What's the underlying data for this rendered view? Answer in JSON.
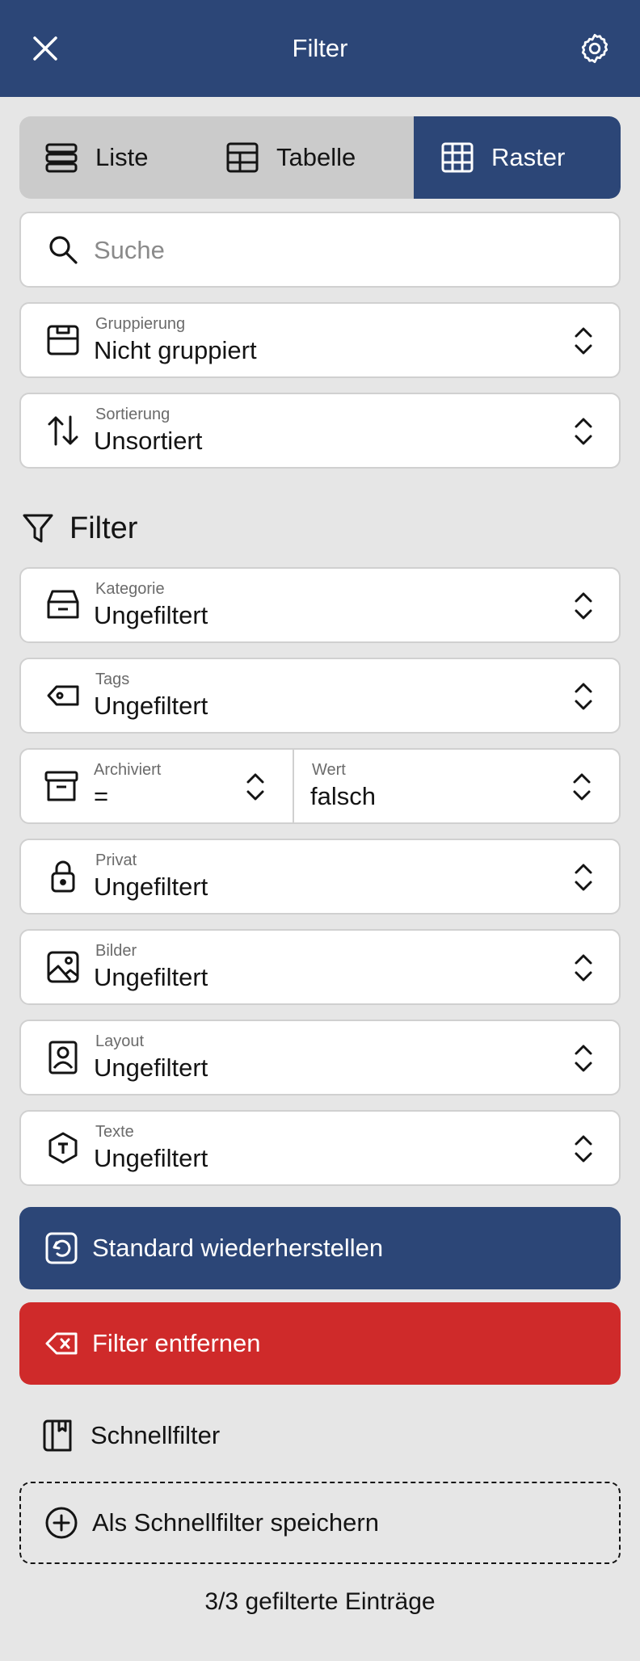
{
  "header": {
    "title": "Filter",
    "close_icon": "close-icon",
    "settings_icon": "gear-icon"
  },
  "view_modes": [
    {
      "label": "Liste",
      "icon": "list-icon",
      "active": false
    },
    {
      "label": "Tabelle",
      "icon": "table-icon",
      "active": false
    },
    {
      "label": "Raster",
      "icon": "grid-icon",
      "active": true
    }
  ],
  "search": {
    "placeholder": "Suche"
  },
  "grouping": {
    "label": "Gruppierung",
    "value": "Nicht gruppiert"
  },
  "sorting": {
    "label": "Sortierung",
    "value": "Unsortiert"
  },
  "filter_section": {
    "title": "Filter"
  },
  "filters": {
    "kategorie": {
      "label": "Kategorie",
      "value": "Ungefiltert"
    },
    "tags": {
      "label": "Tags",
      "value": "Ungefiltert"
    },
    "archiviert": {
      "label": "Archiviert",
      "operator": "=",
      "value_label": "Wert",
      "value": "falsch"
    },
    "privat": {
      "label": "Privat",
      "value": "Ungefiltert"
    },
    "bilder": {
      "label": "Bilder",
      "value": "Ungefiltert"
    },
    "layout": {
      "label": "Layout",
      "value": "Ungefiltert"
    },
    "texte": {
      "label": "Texte",
      "value": "Ungefiltert"
    }
  },
  "actions": {
    "restore_default": "Standard wiederherstellen",
    "remove_filter": "Filter entfernen"
  },
  "quick_filters": {
    "title": "Schnellfilter",
    "save_label": "Als Schnellfilter speichern"
  },
  "footer": {
    "count_text": "3/3 gefilterte Einträge"
  },
  "colors": {
    "primary": "#2c4677",
    "danger": "#cf2a2a",
    "background": "#e6e6e6"
  }
}
